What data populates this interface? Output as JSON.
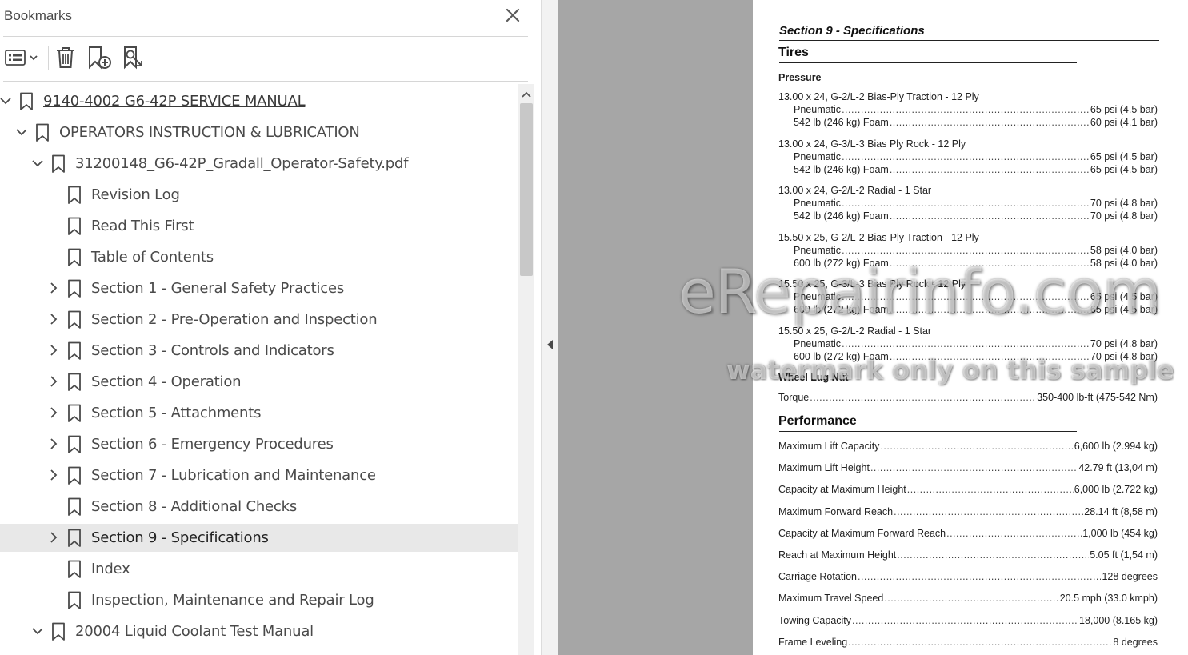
{
  "bookmarks_panel": {
    "title": "Bookmarks",
    "toolbar": {
      "options_icon": "list-options-icon",
      "delete_icon": "trash-icon",
      "new_bookmark_icon": "add-bookmark-icon",
      "find_bookmark_icon": "find-bookmark-icon"
    },
    "items": [
      {
        "label": "9140-4002 G6-42P SERVICE MANUAL",
        "level": 0,
        "expander": "expanded",
        "link": true
      },
      {
        "label": "OPERATORS INSTRUCTION & LUBRICATION",
        "level": 1,
        "expander": "expanded"
      },
      {
        "label": "31200148_G6-42P_Gradall_Operator-Safety.pdf",
        "level": 2,
        "expander": "expanded"
      },
      {
        "label": "Revision Log",
        "level": 3,
        "expander": "none"
      },
      {
        "label": "Read This First",
        "level": 3,
        "expander": "none"
      },
      {
        "label": "Table of Contents",
        "level": 3,
        "expander": "none"
      },
      {
        "label": "Section 1 - General Safety Practices",
        "level": 3,
        "expander": "collapsed"
      },
      {
        "label": "Section 2 - Pre-Operation and Inspection",
        "level": 3,
        "expander": "collapsed"
      },
      {
        "label": "Section 3 - Controls and Indicators",
        "level": 3,
        "expander": "collapsed"
      },
      {
        "label": "Section 4 - Operation",
        "level": 3,
        "expander": "collapsed"
      },
      {
        "label": "Section 5 - Attachments",
        "level": 3,
        "expander": "collapsed"
      },
      {
        "label": "Section 6 - Emergency Procedures",
        "level": 3,
        "expander": "collapsed"
      },
      {
        "label": "Section 7 - Lubrication and Maintenance",
        "level": 3,
        "expander": "collapsed"
      },
      {
        "label": "Section 8 - Additional Checks",
        "level": 3,
        "expander": "none"
      },
      {
        "label": "Section 9 - Specifications",
        "level": 3,
        "expander": "collapsed",
        "selected": true
      },
      {
        "label": "Index",
        "level": 3,
        "expander": "none"
      },
      {
        "label": "Inspection, Maintenance and Repair Log",
        "level": 3,
        "expander": "none"
      },
      {
        "label": "20004 Liquid Coolant Test Manual",
        "level": 2,
        "expander": "expanded"
      }
    ]
  },
  "document": {
    "section_title": "Section 9 - Specifications",
    "tires_heading": "Tires",
    "pressure_heading": "Pressure",
    "tire_groups": [
      {
        "title": "13.00 x 24, G-2/L-2 Bias-Ply Traction - 12 Ply",
        "rows": [
          [
            "Pneumatic",
            "65 psi (4.5 bar)"
          ],
          [
            "542 lb (246 kg) Foam",
            "60 psi (4.1 bar)"
          ]
        ]
      },
      {
        "title": "13.00 x 24, G-3/L-3 Bias Ply Rock - 12 Ply",
        "rows": [
          [
            "Pneumatic",
            "65 psi (4.5 bar)"
          ],
          [
            "542 lb (246 kg) Foam",
            "65 psi (4.5 bar)"
          ]
        ]
      },
      {
        "title": "13.00 x 24, G-2/L-2 Radial - 1 Star",
        "rows": [
          [
            "Pneumatic",
            "70 psi (4.8 bar)"
          ],
          [
            "542 lb (246 kg) Foam",
            "70 psi (4.8 bar)"
          ]
        ]
      },
      {
        "title": "15.50 x 25, G-2/L-2 Bias-Ply Traction - 12 Ply",
        "rows": [
          [
            "Pneumatic",
            "58 psi (4.0 bar)"
          ],
          [
            "600 lb (272 kg) Foam",
            "58 psi (4.0 bar)"
          ]
        ]
      },
      {
        "title": "15.50 x 25, G-3/L-3 Bias Ply Rock - 12 Ply",
        "rows": [
          [
            "Pneumatic",
            "65 psi (4.5 bar)"
          ],
          [
            "600 lb (272 kg) Foam",
            "65 psi (4.5 bar)"
          ]
        ]
      },
      {
        "title": "15.50 x 25, G-2/L-2 Radial - 1 Star",
        "rows": [
          [
            "Pneumatic",
            "70 psi (4.8 bar)"
          ],
          [
            "600 lb (272 kg) Foam",
            "70 psi (4.8 bar)"
          ]
        ]
      }
    ],
    "lug_heading": "Wheel Lug Nut",
    "torque": [
      "Torque",
      "350-400 lb-ft (475-542 Nm)"
    ],
    "performance_heading": "Performance",
    "performance": [
      [
        "Maximum Lift Capacity",
        "6,600 lb (2.994 kg)"
      ],
      [
        "Maximum Lift Height",
        "42.79 ft (13,04 m)"
      ],
      [
        "Capacity at Maximum Height",
        "6,000 lb (2.722 kg)"
      ],
      [
        "Maximum Forward Reach",
        "28.14 ft (8,58 m)"
      ],
      [
        "Capacity at Maximum Forward Reach",
        "1,000 lb (454 kg)"
      ],
      [
        "Reach at Maximum Height",
        "5.05 ft (1,54 m)"
      ],
      [
        "Carriage Rotation",
        "128 degrees"
      ],
      [
        "Maximum Travel Speed",
        "20.5 mph (33.0 kmph)"
      ],
      [
        "Towing Capacity",
        "18,000 (8.165 kg)"
      ],
      [
        "Frame Leveling",
        "8 degrees"
      ]
    ]
  },
  "watermark": {
    "line1": "eRepairinfo.com",
    "line2": "watermark only on this sample"
  }
}
